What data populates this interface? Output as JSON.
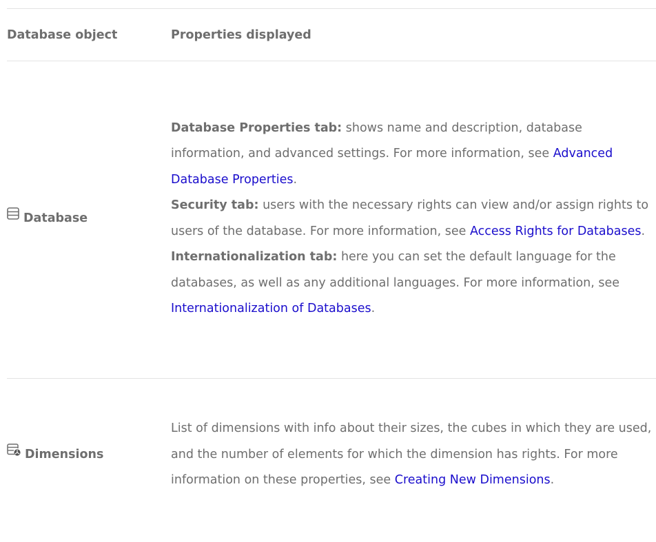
{
  "table": {
    "headers": [
      "Database object",
      "Properties displayed"
    ],
    "rows": [
      {
        "object": "Database",
        "icon": "database-icon",
        "paragraphs": [
          {
            "bold": "Database Properties tab:",
            "text": " shows name and description, database information, and advanced settings. For more information, see ",
            "link": "Advanced Database Properties",
            "tail": "."
          },
          {
            "bold": "Security tab:",
            "text": " users with the necessary rights can view and/or assign rights to users of the database. For more information, see ",
            "link": "Access Rights for Databases",
            "tail": "."
          },
          {
            "bold": "Internationalization tab:",
            "text": " here you can set the default language for the databases, as well as any additional languages. For more information, see ",
            "link": "Internationalization of Databases",
            "tail": "."
          }
        ]
      },
      {
        "object": "Dimensions",
        "icon": "dimensions-icon",
        "paragraphs": [
          {
            "text": "List of dimensions with info about their sizes, the cubes in which they are used, and the number of elements for which the dimension has rights. For more information on these properties, see ",
            "link": "Creating New Dimensions",
            "tail": "."
          }
        ]
      }
    ]
  },
  "colors": {
    "text": "#6e6e6e",
    "link": "#1a0dcc",
    "divider": "#e3e3e3"
  }
}
